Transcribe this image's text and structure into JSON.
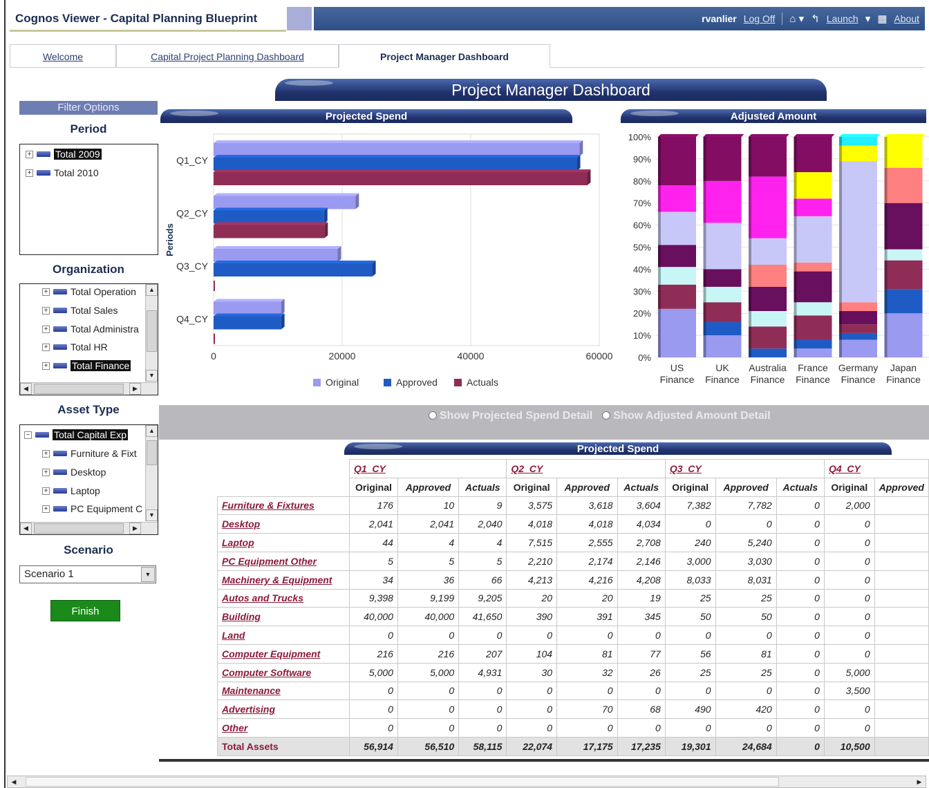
{
  "header": {
    "app_title": "Cognos Viewer - Capital Planning Blueprint",
    "user": "rvanlier",
    "log_off": "Log Off",
    "launch": "Launch",
    "about": "About"
  },
  "tabs": [
    {
      "label": "Welcome"
    },
    {
      "label": "Capital Project Planning Dashboard"
    },
    {
      "label": "Project Manager Dashboard"
    }
  ],
  "dashboard_title": "Project Manager Dashboard",
  "filters": {
    "title": "Filter Options",
    "period": {
      "label": "Period",
      "items": [
        {
          "label": "Total 2009",
          "selected": true
        },
        {
          "label": "Total 2010",
          "selected": false
        }
      ]
    },
    "organization": {
      "label": "Organization",
      "items": [
        {
          "label": "Total Operation",
          "selected": false
        },
        {
          "label": "Total Sales",
          "selected": false
        },
        {
          "label": "Total Administra",
          "selected": false
        },
        {
          "label": "Total HR",
          "selected": false
        },
        {
          "label": "Total Finance",
          "selected": true
        }
      ]
    },
    "asset_type": {
      "label": "Asset Type",
      "items": [
        {
          "label": "Total Capital Exp",
          "selected": true
        },
        {
          "label": "Furniture & Fixt",
          "selected": false
        },
        {
          "label": "Desktop",
          "selected": false
        },
        {
          "label": "Laptop",
          "selected": false
        },
        {
          "label": "PC Equipment C",
          "selected": false
        }
      ]
    },
    "scenario": {
      "label": "Scenario",
      "value": "Scenario 1"
    },
    "finish_label": "Finish"
  },
  "radio_options": {
    "spend_detail": "Show Projected Spend Detail",
    "adjusted_detail": "Show Adjusted Amount Detail"
  },
  "chart_data": [
    {
      "type": "bar",
      "orientation": "horizontal",
      "title": "Projected Spend",
      "ylabel": "Periods",
      "categories": [
        "Q1_CY",
        "Q2_CY",
        "Q3_CY",
        "Q4_CY"
      ],
      "series": [
        {
          "name": "Original",
          "color": "#9a9af0",
          "values": [
            56914,
            22074,
            19301,
            10500
          ]
        },
        {
          "name": "Approved",
          "color": "#1f5bc4",
          "values": [
            56510,
            17175,
            24684,
            10500
          ]
        },
        {
          "name": "Actuals",
          "color": "#8f2d56",
          "values": [
            58115,
            17235,
            0,
            0
          ]
        }
      ],
      "xlim": [
        0,
        60000
      ],
      "xticks": [
        "0",
        "20000",
        "40000",
        "60000"
      ],
      "legend_position": "bottom",
      "grid": true
    },
    {
      "type": "bar",
      "stacked": "percent",
      "title": "Adjusted Amount",
      "categories": [
        "US Finance",
        "UK Finance",
        "Australia Finance",
        "France Finance",
        "Germany Finance",
        "Japan Finance"
      ],
      "yticks": [
        "0%",
        "10%",
        "20%",
        "30%",
        "40%",
        "50%",
        "60%",
        "70%",
        "80%",
        "90%",
        "100%"
      ],
      "ylim": [
        0,
        100
      ],
      "segments": [
        [
          [
            22,
            "#9a9af0"
          ],
          [
            11,
            "#8f2d56"
          ],
          [
            8,
            "#c8f6f6"
          ],
          [
            10,
            "#680f5e"
          ],
          [
            15,
            "#c8c8f8"
          ],
          [
            12,
            "#ff22ee"
          ],
          [
            22,
            "#820d63"
          ]
        ],
        [
          [
            10,
            "#9a9af0"
          ],
          [
            6,
            "#1f5bc4"
          ],
          [
            9,
            "#8f2d56"
          ],
          [
            7,
            "#c8f6f6"
          ],
          [
            8,
            "#680f5e"
          ],
          [
            21,
            "#c8c8f8"
          ],
          [
            19,
            "#ff22ee"
          ],
          [
            20,
            "#820d63"
          ]
        ],
        [
          [
            4,
            "#1f5bc4"
          ],
          [
            10,
            "#8f2d56"
          ],
          [
            7,
            "#c8f6f6"
          ],
          [
            11,
            "#680f5e"
          ],
          [
            10,
            "#ff8080"
          ],
          [
            12,
            "#c8c8f8"
          ],
          [
            28,
            "#ff22ee"
          ],
          [
            18,
            "#820d63"
          ]
        ],
        [
          [
            4,
            "#9a9af0"
          ],
          [
            4,
            "#1f5bc4"
          ],
          [
            11,
            "#8f2d56"
          ],
          [
            6,
            "#c8f6f6"
          ],
          [
            14,
            "#680f5e"
          ],
          [
            4,
            "#ff8080"
          ],
          [
            21,
            "#c8c8f8"
          ],
          [
            8,
            "#ff22ee"
          ],
          [
            12,
            "#ffff00"
          ],
          [
            16,
            "#820d63"
          ]
        ],
        [
          [
            8,
            "#9a9af0"
          ],
          [
            3,
            "#1f5bc4"
          ],
          [
            4,
            "#8f2d56"
          ],
          [
            6,
            "#680f5e"
          ],
          [
            4,
            "#ff8080"
          ],
          [
            64,
            "#c8c8f8"
          ],
          [
            7,
            "#ffff00"
          ],
          [
            4,
            "#22eeff"
          ]
        ],
        [
          [
            20,
            "#9a9af0"
          ],
          [
            11,
            "#1f5bc4"
          ],
          [
            13,
            "#8f2d56"
          ],
          [
            5,
            "#c8f6f6"
          ],
          [
            21,
            "#680f5e"
          ],
          [
            16,
            "#ff8080"
          ],
          [
            14,
            "#ffff00"
          ]
        ]
      ],
      "grid": true
    }
  ],
  "table": {
    "title": "Projected Spend",
    "quarters": [
      "Q1_CY",
      "Q2_CY",
      "Q3_CY",
      "Q4_CY"
    ],
    "measures": [
      "Original",
      "Approved",
      "Actuals",
      "Original",
      "Approved",
      "Actuals",
      "Original",
      "Approved",
      "Actuals",
      "Original",
      "Approved"
    ],
    "rows": [
      {
        "label": "Furniture & Fixtures",
        "values": [
          "176",
          "10",
          "9",
          "3,575",
          "3,618",
          "3,604",
          "7,382",
          "7,782",
          "0",
          "2,000",
          ""
        ]
      },
      {
        "label": "Desktop",
        "values": [
          "2,041",
          "2,041",
          "2,040",
          "4,018",
          "4,018",
          "4,034",
          "0",
          "0",
          "0",
          "0",
          ""
        ]
      },
      {
        "label": "Laptop",
        "values": [
          "44",
          "4",
          "4",
          "7,515",
          "2,555",
          "2,708",
          "240",
          "5,240",
          "0",
          "0",
          ""
        ]
      },
      {
        "label": "PC Equipment Other",
        "values": [
          "5",
          "5",
          "5",
          "2,210",
          "2,174",
          "2,146",
          "3,000",
          "3,030",
          "0",
          "0",
          ""
        ]
      },
      {
        "label": "Machinery & Equipment",
        "values": [
          "34",
          "36",
          "66",
          "4,213",
          "4,216",
          "4,208",
          "8,033",
          "8,031",
          "0",
          "0",
          ""
        ]
      },
      {
        "label": "Autos and Trucks",
        "values": [
          "9,398",
          "9,199",
          "9,205",
          "20",
          "20",
          "19",
          "25",
          "25",
          "0",
          "0",
          ""
        ]
      },
      {
        "label": "Building",
        "values": [
          "40,000",
          "40,000",
          "41,650",
          "390",
          "391",
          "345",
          "50",
          "50",
          "0",
          "0",
          ""
        ]
      },
      {
        "label": "Land",
        "values": [
          "0",
          "0",
          "0",
          "0",
          "0",
          "0",
          "0",
          "0",
          "0",
          "0",
          ""
        ]
      },
      {
        "label": "Computer Equipment",
        "values": [
          "216",
          "216",
          "207",
          "104",
          "81",
          "77",
          "56",
          "81",
          "0",
          "0",
          ""
        ]
      },
      {
        "label": "Computer Software",
        "values": [
          "5,000",
          "5,000",
          "4,931",
          "30",
          "32",
          "26",
          "25",
          "25",
          "0",
          "5,000",
          ""
        ]
      },
      {
        "label": "Maintenance",
        "values": [
          "0",
          "0",
          "0",
          "0",
          "0",
          "0",
          "0",
          "0",
          "0",
          "3,500",
          ""
        ]
      },
      {
        "label": "Advertising",
        "values": [
          "0",
          "0",
          "0",
          "0",
          "70",
          "68",
          "490",
          "420",
          "0",
          "0",
          ""
        ]
      },
      {
        "label": "Other",
        "values": [
          "0",
          "0",
          "0",
          "0",
          "0",
          "0",
          "0",
          "0",
          "0",
          "0",
          ""
        ]
      }
    ],
    "total": {
      "label": "Total Assets",
      "values": [
        "56,914",
        "56,510",
        "58,115",
        "22,074",
        "17,175",
        "17,235",
        "19,301",
        "24,684",
        "0",
        "10,500",
        ""
      ]
    }
  }
}
